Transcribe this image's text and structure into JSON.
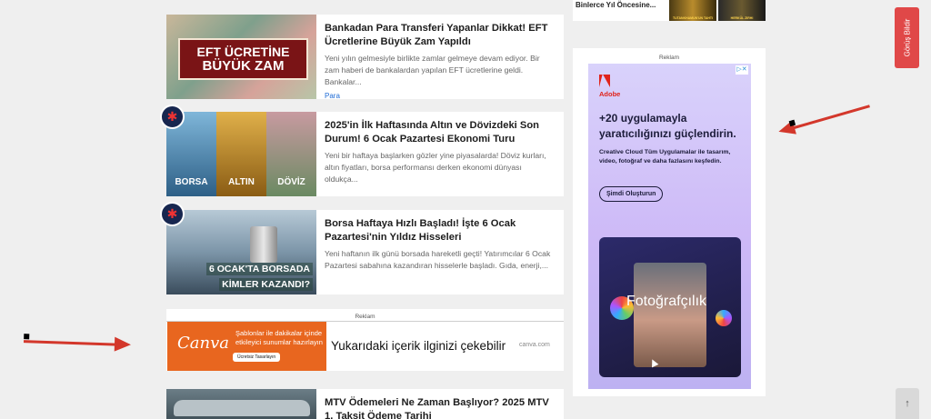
{
  "top_partial": {
    "text": "Binlerce Yıl Öncesine...",
    "thumb1": "TUTANKHAMUN'UN TAHTI",
    "thumb2": "HERKÜL ZIRHI"
  },
  "articles": [
    {
      "title": "Bankadan Para Transferi Yapanlar Dikkat! EFT Ücretlerine Büyük Zam Yapıldı",
      "excerpt": "Yeni yılın gelmesiyle birlikte zamlar gelmeye devam ediyor. Bir zam haberi de bankalardan yapılan EFT ücretlerine geldi. Bankalar...",
      "category": "Para",
      "thumb_line1": "EFT ÜCRETİNE",
      "thumb_line2": "BÜYÜK ZAM"
    },
    {
      "title": "2025'in İlk Haftasında Altın ve Dövizdeki Son Durum! 6 Ocak Pazartesi Ekonomi Turu",
      "excerpt": "Yeni bir haftaya başlarken gözler yine piyasalarda! Döviz kurları, altın fiyatları, borsa performansı derken ekonomi dünyası oldukça...",
      "labels": [
        "BORSA",
        "ALTIN",
        "DÖVİZ"
      ]
    },
    {
      "title": "Borsa Haftaya Hızlı Başladı! İşte 6 Ocak Pazartesi'nin Yıldız Hisseleri",
      "excerpt": "Yeni haftanın ilk günü borsada hareketli geçti! Yatırımcılar 6 Ocak Pazartesi sabahına kazandıran hisselerle başladı. Gıda, enerji,...",
      "thumb_line1": "6 OCAK'TA BORSADA",
      "thumb_line2": "KİMLER KAZANDI?"
    },
    {
      "title": "MTV Ödemeleri Ne Zaman Başlıyor? 2025 MTV 1. Taksit Ödeme Tarihi"
    }
  ],
  "inline_ad": {
    "label": "Reklam",
    "brand": "Canva",
    "line1": "Şablonlar ile dakikalar içinde",
    "line2": "etkileyici sunumlar hazırlayın",
    "button": "Ücretsiz Tasarlayın",
    "overlay": "Yukarıdaki içerik ilginizi çekebilir",
    "domain": "canva.com"
  },
  "side_ad": {
    "label": "Reklam",
    "brand": "Adobe",
    "headline": "+20 uygulamayla yaratıcılığınızı güçlendirin.",
    "body": "Creative Cloud Tüm Uygulamalar ile tasarım, video, fotoğraf ve daha fazlasını keşfedin.",
    "cta": "Şimdi Oluşturun",
    "image_text": "Fotoğrafçılık"
  },
  "feedback_button": "Görüş Bildir",
  "colors": {
    "arrow": "#d3372b",
    "feedback": "#e04848",
    "canva": "#e8661f"
  }
}
